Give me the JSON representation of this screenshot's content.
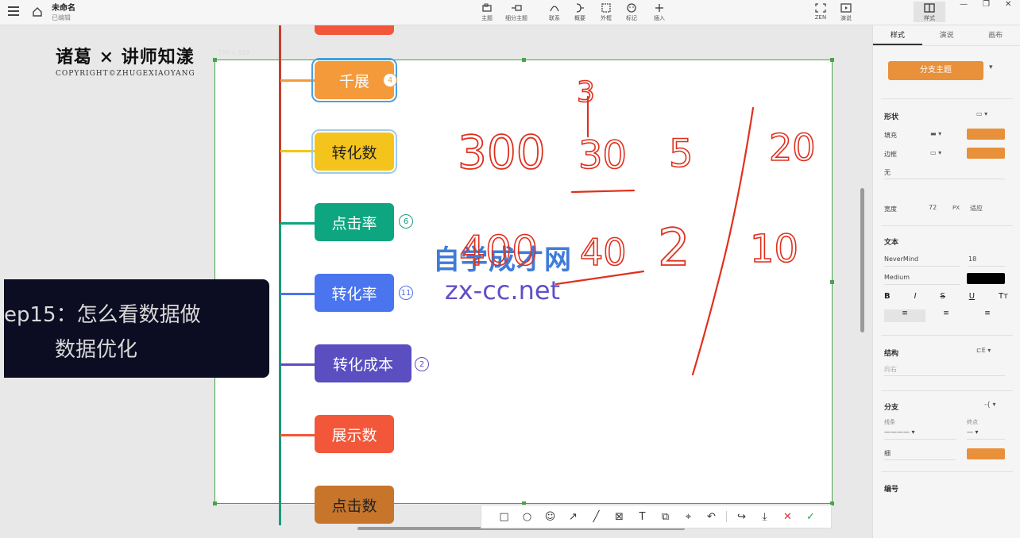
{
  "topbar": {
    "doc_title": "未命名",
    "doc_status": "已编辑",
    "tools": [
      {
        "label": "主题",
        "icon": "topic-icon"
      },
      {
        "label": "细分主题",
        "icon": "subtopic-icon"
      },
      {
        "label": "联系",
        "icon": "relation-icon"
      },
      {
        "label": "概要",
        "icon": "summary-icon"
      },
      {
        "label": "外框",
        "icon": "boundary-icon"
      },
      {
        "label": "标记",
        "icon": "marker-icon"
      },
      {
        "label": "插入",
        "icon": "insert-icon"
      }
    ],
    "right_tools": [
      {
        "label": "ZEN",
        "icon": "zen-icon"
      },
      {
        "label": "演说",
        "icon": "present-icon"
      },
      {
        "label": "样式",
        "icon": "style-panel-icon"
      }
    ]
  },
  "canvas": {
    "capture_size": "759 x 833",
    "logo_text": "诸葛 × 讲师知漾",
    "logo_copyright": "COPYRIGHT©ZHUGEXIAOYANG",
    "episode_line1": "ep15：怎么看数据做",
    "episode_line2": "数据优化",
    "watermark_line1": "自学成才网",
    "watermark_line2": "zx-cc.net",
    "nodes": [
      {
        "label": "千展",
        "color": "#f59a3a",
        "badge": "4",
        "badge_color": "#f0a347"
      },
      {
        "label": "转化数",
        "color": "#f5c41c",
        "badge": "",
        "badge_color": ""
      },
      {
        "label": "点击率",
        "color": "#0ea581",
        "badge": "6",
        "badge_color": "#19a07f"
      },
      {
        "label": "转化率",
        "color": "#4a75ee",
        "badge": "11",
        "badge_color": "#4a6ee0"
      },
      {
        "label": "转化成本",
        "color": "#5a4ec0",
        "badge": "2",
        "badge_color": "#5a4ec0"
      },
      {
        "label": "展示数",
        "color": "#f2573a",
        "badge": "",
        "badge_color": ""
      },
      {
        "label": "点击数",
        "color": "#c8752c",
        "badge": "",
        "badge_color": ""
      }
    ],
    "handwriting": {
      "row1": [
        "300",
        "3",
        "30",
        "5",
        "20"
      ],
      "row2": [
        "400",
        "40",
        "2",
        "10"
      ]
    }
  },
  "annotation_toolbar": {
    "tools": [
      "rectangle-icon",
      "circle-icon",
      "emoji-icon",
      "arrow-icon",
      "pen-icon",
      "mosaic-icon",
      "text-icon",
      "copy-icon",
      "pin-icon",
      "undo-icon",
      "share-icon",
      "save-icon",
      "cancel-icon",
      "confirm-icon"
    ]
  },
  "panel": {
    "tabs": [
      "样式",
      "演说",
      "画布"
    ],
    "branch_topic_btn": "分支主题",
    "shape_label": "形状",
    "fill_label": "填充",
    "border_label": "边框",
    "none_label": "无",
    "width_label": "宽度",
    "width_value": "72",
    "width_unit": "PX",
    "fit_label": "适应",
    "text_label": "文本",
    "font_name": "NeverMind",
    "font_size": "18",
    "font_weight": "Medium",
    "structure_label": "结构",
    "structure_value": "向右",
    "branch_label": "分支",
    "line_label": "线条",
    "end_label": "终点",
    "thickness_value": "细",
    "numbering_label": "编号"
  }
}
